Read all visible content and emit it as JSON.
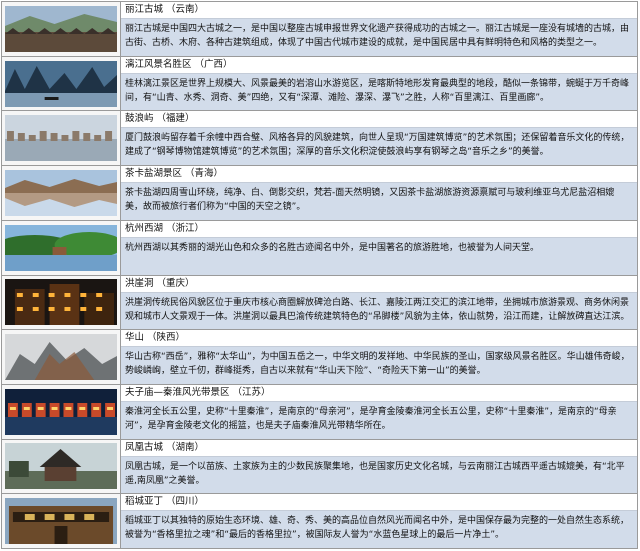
{
  "rows": [
    {
      "name": "丽江古城",
      "region": "（云南）",
      "scene": "town",
      "description": "丽江古城是中国四大古城之一，是中国以整座古城申报世界文化遗产获得成功的古城之一。丽江古城是一座没有城墙的古城，由古街、古桥、木府、各种古建筑组成，体现了中国古代城市建设的成就，是中国民居中具有鲜明特色和风格的类型之一。"
    },
    {
      "name": "漓江风景名胜区",
      "region": "（广西）",
      "scene": "karst",
      "description": "桂林漓江景区是世界上规模大、风景最美的岩溶山水游览区，是喀斯特地形发育最典型的地段，酷似一条锦带，蜿蜒于万千奇峰间，有“山青、水秀、洞奇、美”四绝，又有“深潭、滩险、瀑深、瀑飞”之胜，人称“百里漓江、百里画廊”。"
    },
    {
      "name": "鼓浪屿",
      "region": "（福建）",
      "scene": "island",
      "description": "厦门鼓浪屿留存着千余幢中西合璧、风格各异的风貌建筑，向世人呈现“万国建筑博览”的艺术氛围；还保留着音乐文化的传统，建成了“钢琴博物馆建筑博览”的艺术氛围；深厚的音乐文化积淀使鼓浪屿享有钢琴之岛“音乐之乡”的美誉。"
    },
    {
      "name": "茶卡盐湖景区",
      "region": "（青海）",
      "scene": "saltlake",
      "description": "茶卡盐湖四周雪山环绕，纯净、白、倒影交织，梵若-面天然明镜，又因茶卡盐湖旅游资源禀赋可与玻利维亚乌尤尼盐沼相媲美，故而被旅行者们称为“中国的天空之镜”。"
    },
    {
      "name": "杭州西湖",
      "region": "（浙江）",
      "scene": "westlake",
      "description": "杭州西湖以其秀丽的湖光山色和众多的名胜古迹闻名中外，是中国著名的旅游胜地，也被誉为人间天堂。"
    },
    {
      "name": "洪崖洞",
      "region": "（重庆）",
      "scene": "hongya",
      "description": "洪崖洞传统民俗风貌区位于重庆市核心商圈解放碑沧白路、长江、嘉陵江两江交汇的滨江地带，坐拥城市旅游景观、商务休闲景观和城市人文景观于一体。洪崖洞以最具巴渝传统建筑特色的“吊脚楼”风貌为主体，依山就势，沿江而建，让解放碑直达江滨。"
    },
    {
      "name": "华山",
      "region": "（陕西）",
      "scene": "mountain",
      "description": "华山古称“西岳”，雅称“太华山”，为中国五岳之一，中华文明的发祥地、中华民族的圣山，国家级风景名胜区。华山雄伟奇峻，势峻嶙峋，壁立千仞，群峰挺秀，自古以来就有“华山天下险”、“奇险天下第一山”的美誉。"
    },
    {
      "name": "夫子庙—秦淮风光带景区",
      "region": "（江苏）",
      "scene": "night",
      "description": "秦淮河全长五公里，史称“十里秦淮”，是南京的“母亲河”，是孕育金陵秦淮河全长五公里，史称“十里秦淮”，是南京的“母亲河”，是孕育金陵老文化的摇篮，也是夫子庙秦淮风光带精华所在。"
    },
    {
      "name": "凤凰古城",
      "region": "（湖南）",
      "scene": "phoenix",
      "description": "凤凰古城，是一个以苗族、土家族为主的少数民族聚集地，也是国家历史文化名城，与云南丽江古城西平遥古城媲美，有“北平遥,南凤凰”之美誉。"
    },
    {
      "name": "稻城亚丁",
      "region": "（四川）",
      "scene": "gate",
      "description": "稻城亚丁以其独特的原始生态环境、雄、奇、秀、美的高品位自然风光而闻名中外，是中国保存最为完整的一处自然生态系统，被誉为“香格里拉之魂”和“最后的香格里拉”，被国际友人誉为“水蓝色星球上的最后一片净土”。"
    }
  ]
}
